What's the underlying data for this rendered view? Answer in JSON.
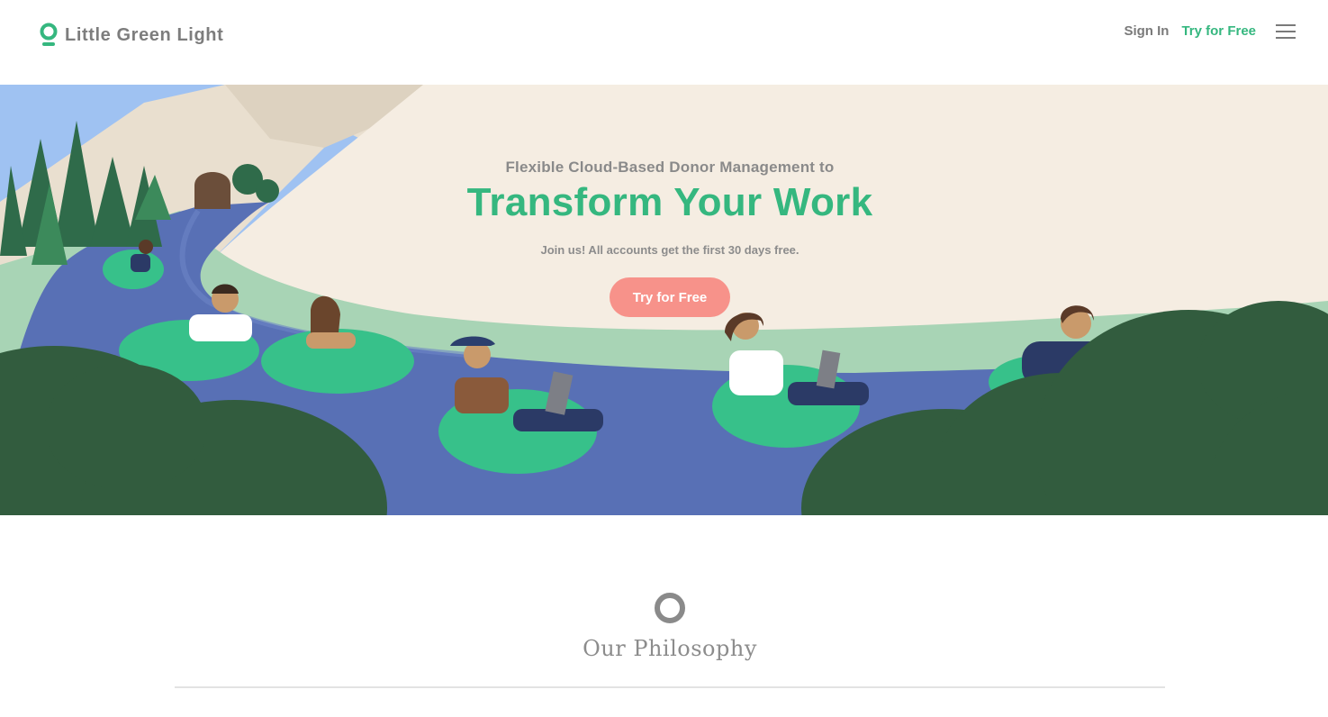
{
  "brand": {
    "name": "Little Green Light",
    "accent": "#35b77f",
    "cta_color": "#f7928a",
    "icon": "logo-ring-icon"
  },
  "nav": {
    "sign_in": "Sign In",
    "try_free": "Try for Free",
    "menu_icon": "hamburger-menu-icon"
  },
  "hero": {
    "subtitle": "Flexible Cloud-Based Donor Management to",
    "title": "Transform Your Work",
    "trial_note": "Join us! All accounts get the first 30 days free.",
    "cta_label": "Try for Free"
  },
  "philosophy": {
    "title": "Our Philosophy",
    "icon": "ring-icon"
  }
}
